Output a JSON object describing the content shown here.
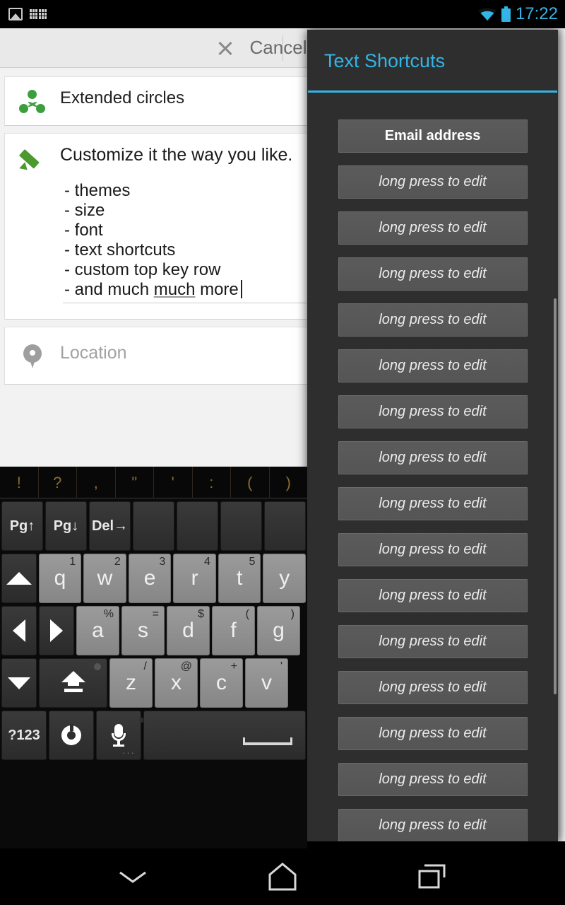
{
  "status_bar": {
    "icons_left": [
      "image-icon",
      "keyboard-icon"
    ],
    "icons_right": [
      "wifi-icon",
      "battery-icon"
    ],
    "time": "17:22",
    "accent_color": "#33b5e5"
  },
  "app": {
    "action_bar": {
      "cancel_label": "Cancel",
      "close_icon": "close-icon"
    },
    "audience_row": {
      "icon": "circles-icon",
      "label": "Extended circles"
    },
    "compose": {
      "icon": "pencil-icon",
      "headline": "Customize it the way you like.",
      "bullets": [
        "- themes",
        "- size",
        "- font",
        "- text shortcuts",
        "- custom top key row"
      ],
      "last_bullet_prefix": "- and much ",
      "last_bullet_underlined": "much",
      "last_bullet_suffix": " more"
    },
    "location_row": {
      "icon": "location-pin-icon",
      "placeholder": "Location"
    }
  },
  "dialog": {
    "title": "Text Shortcuts",
    "title_color": "#33b5e5",
    "items": [
      {
        "label": "Email address",
        "state": "filled"
      },
      {
        "label": "long press to edit",
        "state": "empty"
      },
      {
        "label": "long press to edit",
        "state": "empty"
      },
      {
        "label": "long press to edit",
        "state": "empty"
      },
      {
        "label": "long press to edit",
        "state": "empty"
      },
      {
        "label": "long press to edit",
        "state": "empty"
      },
      {
        "label": "long press to edit",
        "state": "empty"
      },
      {
        "label": "long press to edit",
        "state": "empty"
      },
      {
        "label": "long press to edit",
        "state": "empty"
      },
      {
        "label": "long press to edit",
        "state": "empty"
      },
      {
        "label": "long press to edit",
        "state": "empty"
      },
      {
        "label": "long press to edit",
        "state": "empty"
      },
      {
        "label": "long press to edit",
        "state": "empty"
      },
      {
        "label": "long press to edit",
        "state": "empty"
      },
      {
        "label": "long press to edit",
        "state": "empty"
      },
      {
        "label": "long press to edit",
        "state": "empty"
      }
    ]
  },
  "keyboard": {
    "suggestion_strip": [
      "!",
      "?",
      ",",
      "\"",
      "'",
      ":",
      "(",
      ")"
    ],
    "function_row": [
      {
        "label": "Pg↑",
        "name": "page-up-key"
      },
      {
        "label": "Pg↓",
        "name": "page-down-key"
      },
      {
        "label": "Del→",
        "name": "forward-delete-key"
      },
      {
        "label": "",
        "name": "blank-key-1"
      },
      {
        "label": "",
        "name": "blank-key-2"
      },
      {
        "label": "",
        "name": "blank-key-3"
      },
      {
        "label": "",
        "name": "blank-key-4"
      }
    ],
    "row1": [
      {
        "label": "q",
        "hint": "1"
      },
      {
        "label": "w",
        "hint": "2"
      },
      {
        "label": "e",
        "hint": "3"
      },
      {
        "label": "r",
        "hint": "4"
      },
      {
        "label": "t",
        "hint": "5"
      },
      {
        "label": "y",
        "hint": ""
      }
    ],
    "row2": [
      {
        "label": "a",
        "hint": "%"
      },
      {
        "label": "s",
        "hint": "="
      },
      {
        "label": "d",
        "hint": "$"
      },
      {
        "label": "f",
        "hint": "("
      },
      {
        "label": "g",
        "hint": ")"
      }
    ],
    "row3": [
      {
        "label": "z",
        "hint": "/"
      },
      {
        "label": "x",
        "hint": "@"
      },
      {
        "label": "c",
        "hint": "+"
      },
      {
        "label": "v",
        "hint": "'"
      }
    ],
    "bottom_row": {
      "symbols_label": "?123",
      "mic_sub": "···"
    },
    "nav_keys": {
      "arrow_up": "arrow-up-key",
      "arrow_left": "arrow-left-key",
      "arrow_right": "arrow-right-key",
      "arrow_down": "arrow-down-key",
      "shift": "shift-key"
    }
  },
  "nav_bar": {
    "buttons": [
      {
        "name": "hide-keyboard-button",
        "icon": "chevron-down-icon"
      },
      {
        "name": "home-button",
        "icon": "home-icon"
      },
      {
        "name": "recents-button",
        "icon": "recents-icon"
      }
    ]
  }
}
